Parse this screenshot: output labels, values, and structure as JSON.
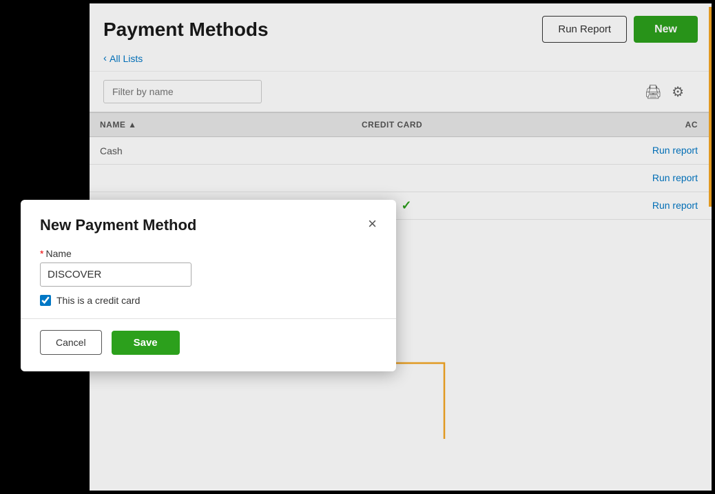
{
  "page": {
    "title": "Payment Methods",
    "background": "#000"
  },
  "header": {
    "title": "Payment Methods",
    "run_report_label": "Run Report",
    "new_label": "New"
  },
  "breadcrumb": {
    "back_label": "All Lists",
    "back_icon": "‹"
  },
  "filter": {
    "placeholder": "Filter by name"
  },
  "table": {
    "columns": [
      {
        "key": "name",
        "label": "NAME ▲"
      },
      {
        "key": "credit_card",
        "label": "CREDIT CARD"
      },
      {
        "key": "action",
        "label": "AC"
      }
    ],
    "rows": [
      {
        "name": "Cash",
        "credit_card": false,
        "action": "Run report"
      },
      {
        "name": "",
        "credit_card": false,
        "action": "Run report"
      },
      {
        "name": "",
        "credit_card": true,
        "action": "Run report"
      }
    ]
  },
  "modal": {
    "title": "New Payment Method",
    "close_icon": "×",
    "name_label": "Name",
    "name_required": true,
    "name_value": "DISCOVER",
    "checkbox_label": "This is a credit card",
    "checkbox_checked": true,
    "cancel_label": "Cancel",
    "save_label": "Save"
  },
  "annotation": {
    "arrow_color": "#f5a623"
  }
}
